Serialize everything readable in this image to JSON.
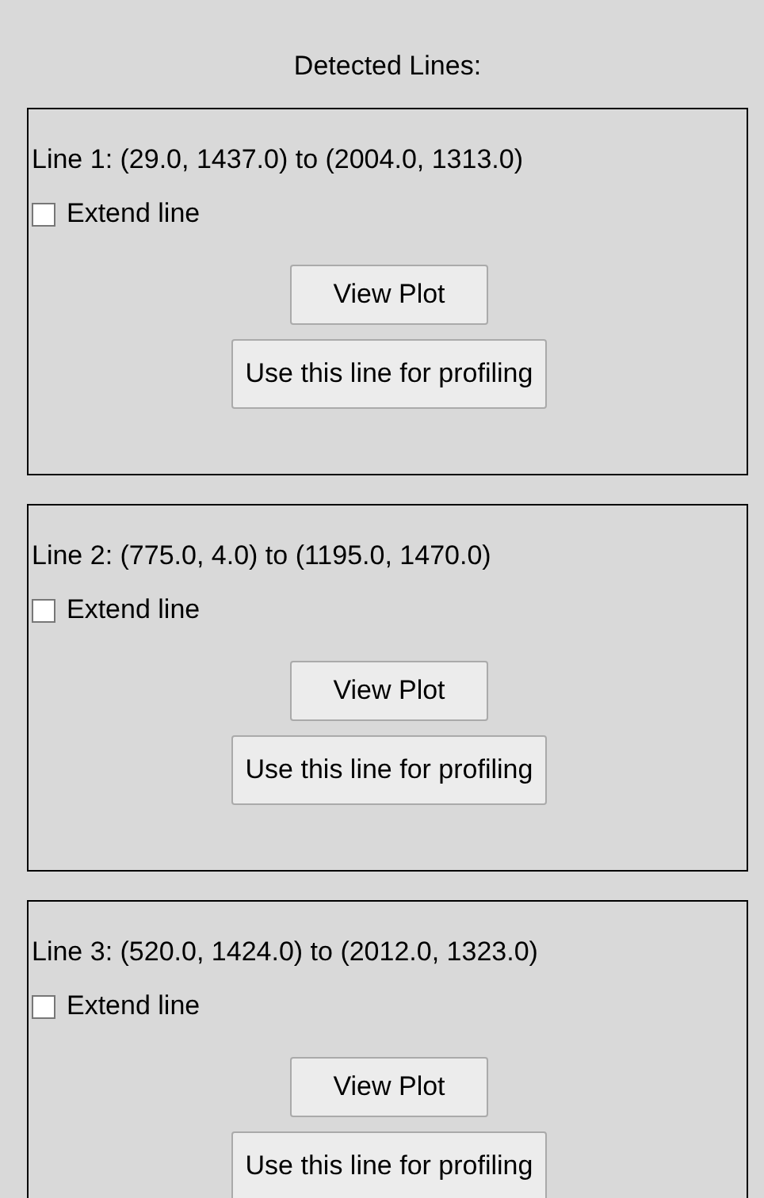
{
  "heading": "Detected Lines:",
  "lines": [
    {
      "label": "Line 1: (29.0, 1437.0) to (2004.0, 1313.0)",
      "extend": {
        "label": "Extend line",
        "checked": false
      },
      "buttons": [
        "View Plot",
        "Use this line for profiling"
      ]
    },
    {
      "label": "Line 2: (775.0, 4.0) to (1195.0, 1470.0)",
      "extend": {
        "label": "Extend line",
        "checked": false
      },
      "buttons": [
        "View Plot",
        "Use this line for profiling"
      ]
    },
    {
      "label": "Line 3: (520.0, 1424.0) to (2012.0, 1323.0)",
      "extend": {
        "label": "Extend line",
        "checked": false
      },
      "buttons": [
        "View Plot",
        "Use this line for profiling"
      ]
    }
  ]
}
